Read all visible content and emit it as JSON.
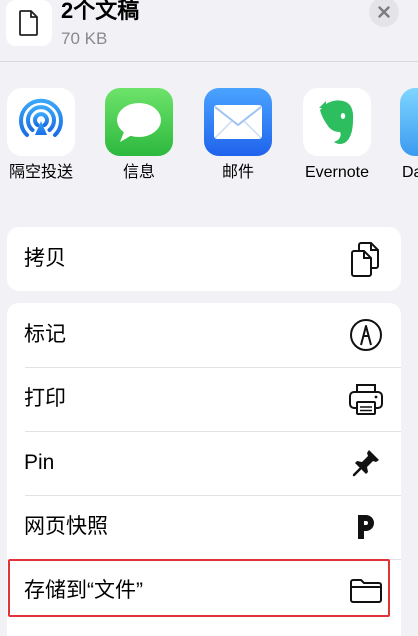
{
  "header": {
    "title": "2个文稿",
    "subtitle": "70 KB",
    "file_icon": "document-icon",
    "close_icon": "close-icon"
  },
  "apps": [
    {
      "label": "隔空投送",
      "icon": "airdrop-icon",
      "color": "#ffffff"
    },
    {
      "label": "信息",
      "icon": "messages-icon",
      "color": "#34c759"
    },
    {
      "label": "邮件",
      "icon": "mail-icon",
      "color": "#2f7cf6"
    },
    {
      "label": "Evernote",
      "icon": "evernote-icon",
      "color": "#2dbe60"
    },
    {
      "label": "Da",
      "icon": "app-icon",
      "color": "#5ac8fa"
    }
  ],
  "actions_group1": [
    {
      "label": "拷贝",
      "icon": "copy-icon"
    }
  ],
  "actions_group2": [
    {
      "label": "标记",
      "icon": "markup-icon"
    },
    {
      "label": "打印",
      "icon": "printer-icon"
    },
    {
      "label": "Pin",
      "icon": "pin-icon"
    },
    {
      "label": "网页快照",
      "icon": "pdf-snapshot-icon"
    },
    {
      "label": "存储到“文件”",
      "icon": "folder-icon"
    }
  ],
  "colors": {
    "background": "#f2f2f6",
    "highlight": "#e0333a"
  }
}
